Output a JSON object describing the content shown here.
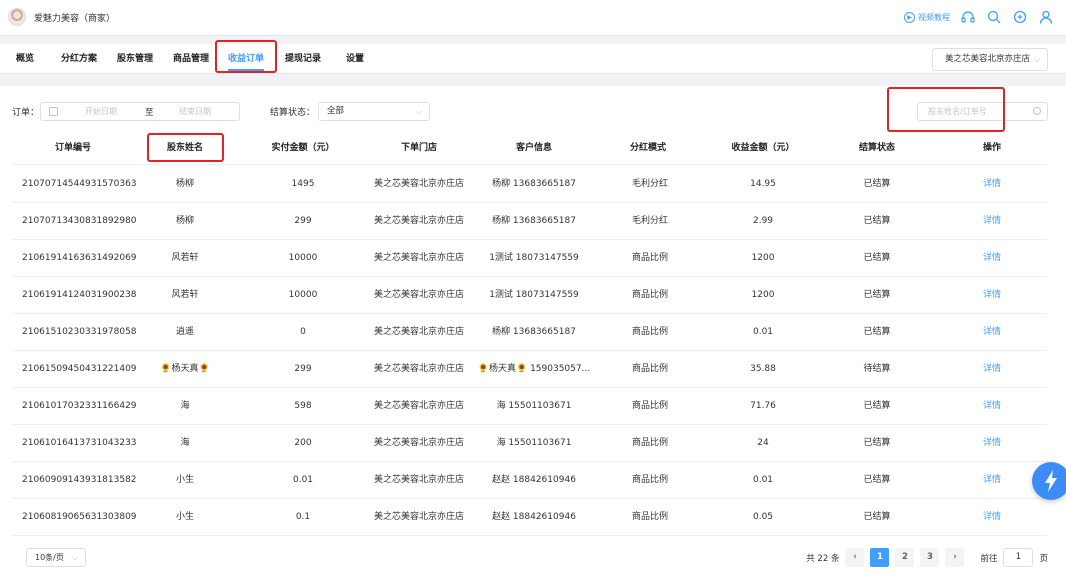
{
  "header": {
    "brand_name": "爱魅力美容（商家）",
    "tutorial_label": "视频教程",
    "tutorial_icon": "play-circle-icon",
    "icons": [
      "headset-icon",
      "search-icon",
      "plus-circle-icon",
      "user-icon"
    ]
  },
  "nav": {
    "tabs": [
      {
        "label": "概览"
      },
      {
        "label": "分红方案"
      },
      {
        "label": "股东管理"
      },
      {
        "label": "商品管理"
      },
      {
        "label": "收益订单",
        "active": true
      },
      {
        "label": "提现记录"
      },
      {
        "label": "设置"
      }
    ],
    "store_select": "美之芯美容北京亦庄店"
  },
  "filters": {
    "order_label": "订单：",
    "start_placeholder": "开始日期",
    "range_sep": "至",
    "end_placeholder": "结束日期",
    "status_label": "结算状态：",
    "status_value": "全部",
    "search_placeholder": "股东姓名/订单号"
  },
  "table": {
    "columns": [
      "订单编号",
      "股东姓名",
      "实付金额（元）",
      "下单门店",
      "客户信息",
      "分红模式",
      "收益金额（元）",
      "结算状态",
      "操作"
    ],
    "rows": [
      [
        "210707145449315703​63",
        "杨柳",
        "1495",
        "美之芯美容北京亦庄店",
        "杨柳 13683665187",
        "毛利分红",
        "14.95",
        "已结算",
        "详情"
      ],
      [
        "21070713430831892980",
        "杨柳",
        "299",
        "美之芯美容北京亦庄店",
        "杨柳 13683665187",
        "毛利分红",
        "2.99",
        "已结算",
        "详情"
      ],
      [
        "21061914163631492069",
        "风若轩",
        "10000",
        "美之芯美容北京亦庄店",
        "1测试 18073147559",
        "商品比例",
        "1200",
        "已结算",
        "详情"
      ],
      [
        "21061914124031900238",
        "风若轩",
        "10000",
        "美之芯美容北京亦庄店",
        "1测试 18073147559",
        "商品比例",
        "1200",
        "已结算",
        "详情"
      ],
      [
        "21061510230331978058",
        "逍遥",
        "0",
        "美之芯美容北京亦庄店",
        "杨柳 13683665187",
        "商品比例",
        "0.01",
        "已结算",
        "详情"
      ],
      [
        "21061509450431221409",
        "🌻杨天真🌻",
        "299",
        "美之芯美容北京亦庄店",
        "🌻杨天真🌻 159035057...",
        "商品比例",
        "35.88",
        "待结算",
        "详情"
      ],
      [
        "21061017032331166429",
        "海",
        "598",
        "美之芯美容北京亦庄店",
        "海 15501103671",
        "商品比例",
        "71.76",
        "已结算",
        "详情"
      ],
      [
        "21061016413731043233",
        "海",
        "200",
        "美之芯美容北京亦庄店",
        "海 15501103671",
        "商品比例",
        "24",
        "已结算",
        "详情"
      ],
      [
        "21060909143931813582",
        "小生",
        "0.01",
        "美之芯美容北京亦庄店",
        "赵赵 18842610946",
        "商品比例",
        "0.01",
        "已结算",
        "详情"
      ],
      [
        "21060819065631303809",
        "小生",
        "0.1",
        "美之芯美容北京亦庄店",
        "赵赵 18842610946",
        "商品比例",
        "0.05",
        "已结算",
        "详情"
      ]
    ]
  },
  "pagination": {
    "page_size": "10条/页",
    "total": "共 22 条",
    "pages": [
      "1",
      "2",
      "3"
    ],
    "current": "1",
    "goto_label": "前往",
    "goto_value": "1",
    "page_suffix": "页"
  },
  "fab_icon": "lightning-icon"
}
